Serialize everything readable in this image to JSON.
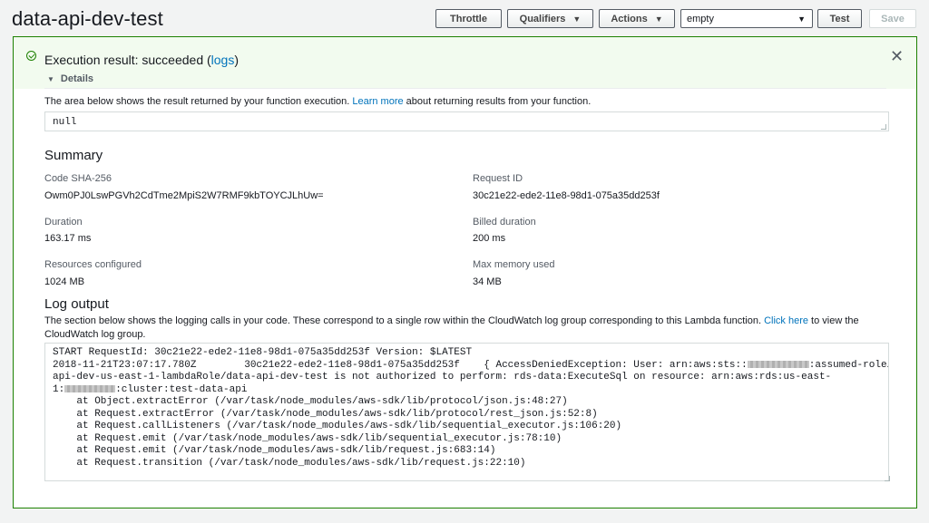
{
  "header": {
    "function_name": "data-api-dev-test",
    "buttons": {
      "throttle": "Throttle",
      "qualifiers": "Qualifiers",
      "actions": "Actions",
      "test": "Test",
      "save": "Save"
    },
    "test_event_selected": "empty"
  },
  "execution": {
    "status_prefix": "Execution result: succeeded (",
    "logs_link": "logs",
    "status_suffix": ")",
    "details_label": "Details",
    "result_desc_before": "The area below shows the result returned by your function execution. ",
    "result_desc_link": "Learn more",
    "result_desc_after": " about returning results from your function.",
    "result_value": "null"
  },
  "summary": {
    "heading": "Summary",
    "fields": {
      "code_sha_label": "Code SHA-256",
      "code_sha_value": "Owm0PJ0LswPGVh2CdTme2MpiS2W7RMF9kbTOYCJLhUw=",
      "request_id_label": "Request ID",
      "request_id_value": "30c21e22-ede2-11e8-98d1-075a35dd253f",
      "duration_label": "Duration",
      "duration_value": "163.17 ms",
      "billed_label": "Billed duration",
      "billed_value": "200 ms",
      "resources_label": "Resources configured",
      "resources_value": "1024 MB",
      "max_memory_label": "Max memory used",
      "max_memory_value": "34 MB"
    }
  },
  "log": {
    "heading": "Log output",
    "desc_before": "The section below shows the logging calls in your code. These correspond to a single row within the CloudWatch log group corresponding to this Lambda function. ",
    "desc_link": "Click here",
    "desc_after": " to view the CloudWatch log group.",
    "lines": {
      "l1": "START RequestId: 30c21e22-ede2-11e8-98d1-075a35dd253f Version: $LATEST",
      "l2a": "2018-11-21T23:07:17.780Z\t30c21e22-ede2-11e8-98d1-075a35dd253f\t{ AccessDeniedException: User: arn:aws:sts::",
      "l2b": ":assumed-role/data-",
      "l3": "api-dev-us-east-1-lambdaRole/data-api-dev-test is not authorized to perform: rds-data:ExecuteSql on resource: arn:aws:rds:us-east-",
      "l4a": "1:",
      "l4b": ":cluster:test-data-api",
      "l5": "    at Object.extractError (/var/task/node_modules/aws-sdk/lib/protocol/json.js:48:27)",
      "l6": "    at Request.extractError (/var/task/node_modules/aws-sdk/lib/protocol/rest_json.js:52:8)",
      "l7": "    at Request.callListeners (/var/task/node_modules/aws-sdk/lib/sequential_executor.js:106:20)",
      "l8": "    at Request.emit (/var/task/node_modules/aws-sdk/lib/sequential_executor.js:78:10)",
      "l9": "    at Request.emit (/var/task/node_modules/aws-sdk/lib/request.js:683:14)",
      "l10": "    at Request.transition (/var/task/node_modules/aws-sdk/lib/request.js:22:10)"
    }
  },
  "icons": {
    "success": "check-circle-icon",
    "close": "close-icon",
    "caret": "caret-down-icon"
  },
  "colors": {
    "success_border": "#1d8102",
    "success_bg": "#f2fbef",
    "link": "#0073bb"
  }
}
